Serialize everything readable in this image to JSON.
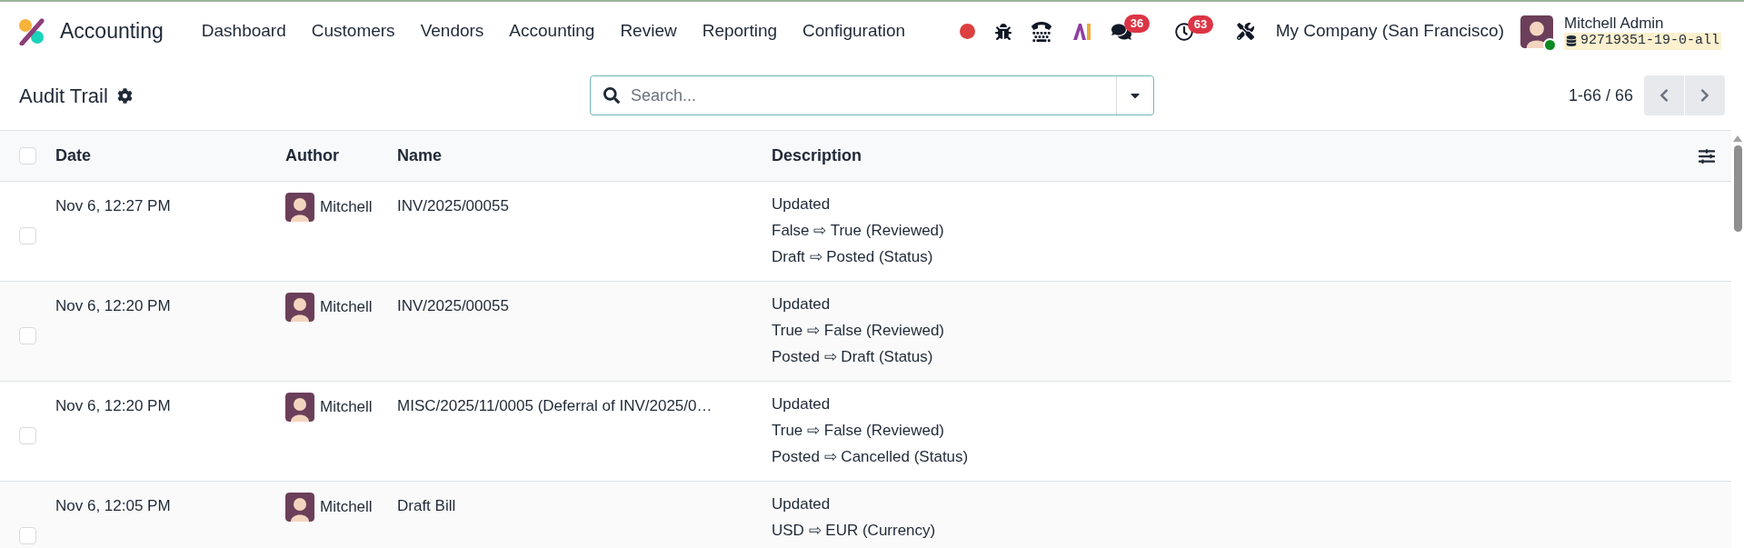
{
  "topbar": {
    "app_name": "Accounting",
    "menu": [
      "Dashboard",
      "Customers",
      "Vendors",
      "Accounting",
      "Review",
      "Reporting",
      "Configuration"
    ],
    "systray": [
      {
        "kind": "record"
      },
      {
        "kind": "bug"
      },
      {
        "kind": "phone"
      },
      {
        "kind": "ai"
      },
      {
        "kind": "chat",
        "count": "36"
      },
      {
        "kind": "clock",
        "count": "63"
      },
      {
        "kind": "tools"
      }
    ],
    "company": "My Company (San Francisco)",
    "user": {
      "name": "Mitchell Admin",
      "database": "92719351-19-0-all"
    }
  },
  "control_panel": {
    "title": "Audit Trail",
    "search": {
      "placeholder": "Search..."
    },
    "pager": "1-66 / 66"
  },
  "table": {
    "select_all_checked": false,
    "columns": [
      "Date",
      "Author",
      "Name",
      "Description"
    ],
    "rows": [
      {
        "checked": false,
        "date": "Nov 6, 12:27 PM",
        "author": "Mitchell",
        "name": "INV/2025/00055",
        "description": [
          "Updated",
          "False ⇨ True (Reviewed)",
          "Draft ⇨ Posted (Status)"
        ]
      },
      {
        "checked": false,
        "date": "Nov 6, 12:20 PM",
        "author": "Mitchell",
        "name": "INV/2025/00055",
        "description": [
          "Updated",
          "True ⇨ False (Reviewed)",
          "Posted ⇨ Draft (Status)"
        ]
      },
      {
        "checked": false,
        "date": "Nov 6, 12:20 PM",
        "author": "Mitchell",
        "name": "MISC/2025/11/0005 (Deferral of INV/2025/0…",
        "description": [
          "Updated",
          "True ⇨ False (Reviewed)",
          "Posted ⇨ Cancelled (Status)"
        ]
      },
      {
        "checked": false,
        "date": "Nov 6, 12:05 PM",
        "author": "Mitchell",
        "name": "Draft Bill",
        "description": [
          "Updated",
          "USD ⇨ EUR (Currency)"
        ]
      }
    ]
  }
}
